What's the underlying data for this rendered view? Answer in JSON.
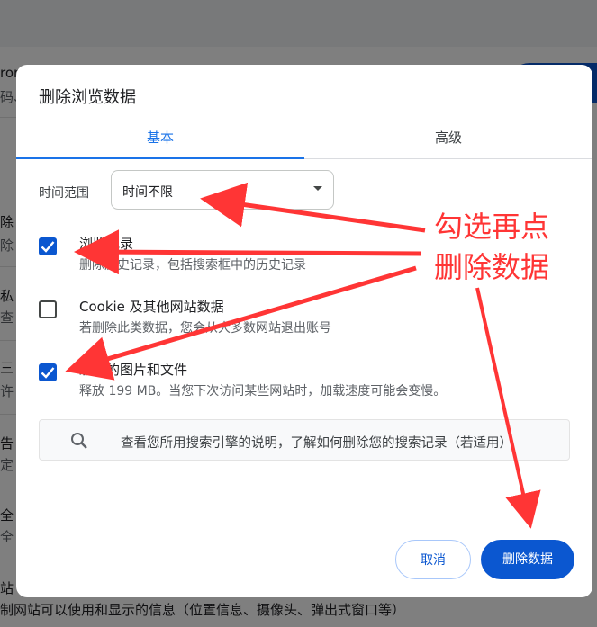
{
  "background": {
    "left_fragments": [
      "ron",
      "码、",
      "",
      "除",
      "除",
      "私",
      "查",
      "三",
      "许",
      "告",
      "定",
      "全",
      "全",
      "站"
    ],
    "footer_text": "制网站可以使用和显示的信息（位置信息、摄像头、弹出式窗口等）"
  },
  "dialog": {
    "title": "删除浏览数据",
    "tabs": [
      {
        "label": "基本",
        "active": true
      },
      {
        "label": "高级",
        "active": false
      }
    ],
    "time_range": {
      "label": "时间范围",
      "value": "时间不限"
    },
    "options": [
      {
        "title": "浏览记录",
        "description": "删除历史记录，包括搜索框中的历史记录",
        "checked": true
      },
      {
        "title": "Cookie 及其他网站数据",
        "description": "若删除此类数据，您会从大多数网站退出账号",
        "checked": false
      },
      {
        "title": "缓存的图片和文件",
        "description": "释放 199 MB。当您下次访问某些网站时，加载速度可能会变慢。",
        "checked": true
      }
    ],
    "search_hint": "查看您所用搜索引擎的说明，了解如何删除您的搜索记录（若适用）",
    "buttons": {
      "cancel": "取消",
      "delete": "删除数据"
    }
  },
  "annotation": {
    "line1": "勾选再点",
    "line2": "删除数据",
    "color": "#ff3535"
  },
  "colors": {
    "accent": "#1a73e8",
    "primary_button": "#0b57d0",
    "annotation": "#ff3535"
  }
}
